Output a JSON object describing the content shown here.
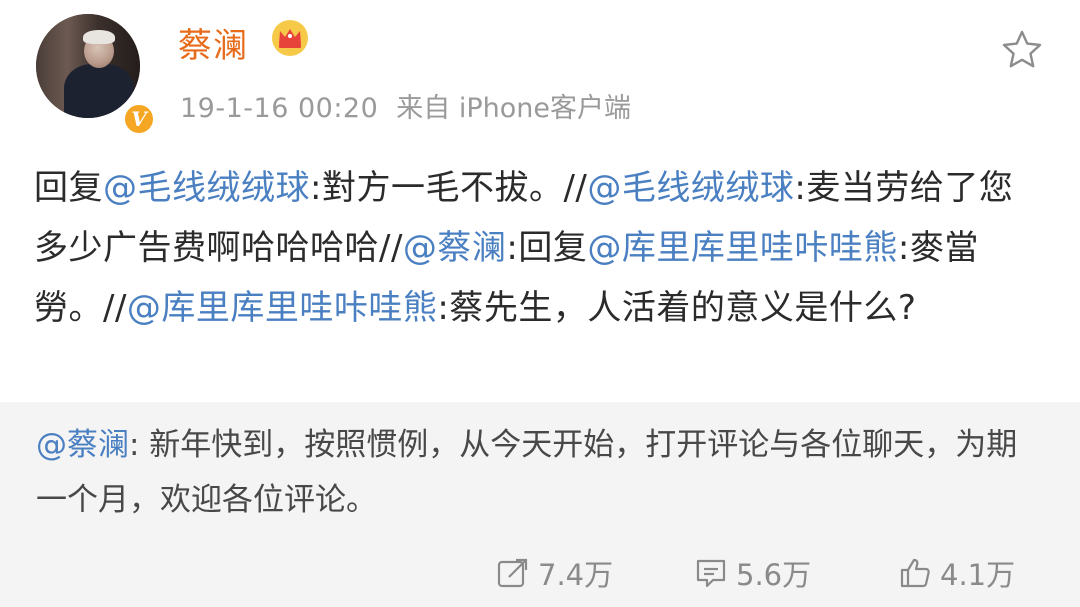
{
  "header": {
    "username": "蔡澜",
    "timestamp": "19-1-16 00:20",
    "source": "来自 iPhone客户端",
    "avatar_icon": "user-avatar",
    "badge_icon": "verified-v-icon",
    "badge_glyph": "V",
    "level_icon": "crown-icon",
    "favorite_icon": "star-outline-icon"
  },
  "post": {
    "segments": [
      {
        "text": "回复",
        "type": "text"
      },
      {
        "text": "@毛线绒绒球",
        "type": "mention"
      },
      {
        "text": ":對方一毛不拔。//",
        "type": "text"
      },
      {
        "text": "@毛线绒绒球",
        "type": "mention"
      },
      {
        "text": ":麦当劳给了您多少广告费啊哈哈哈哈//",
        "type": "text"
      },
      {
        "text": "@蔡澜",
        "type": "mention"
      },
      {
        "text": ":回复",
        "type": "text"
      },
      {
        "text": "@库里库里哇咔哇熊",
        "type": "mention"
      },
      {
        "text": ":麥當勞。//",
        "type": "text"
      },
      {
        "text": "@库里库里哇咔哇熊",
        "type": "mention"
      },
      {
        "text": ":蔡先生，人活着的意义是什么?",
        "type": "text"
      }
    ]
  },
  "quoted": {
    "mention": "@蔡澜",
    "text": ": 新年快到，按照惯例，从今天开始，打开评论与各位聊天，为期一个月，欢迎各位评论。"
  },
  "actions": {
    "repost": {
      "icon": "repost-icon",
      "count": "7.4万"
    },
    "comment": {
      "icon": "comment-icon",
      "count": "5.6万"
    },
    "like": {
      "icon": "thumbs-up-icon",
      "count": "4.1万"
    }
  },
  "colors": {
    "username": "#e86b1a",
    "mention": "#4a7fc1",
    "meta": "#9a9a9a",
    "quoted_bg": "#f4f4f4",
    "badge": "#f5a623"
  }
}
